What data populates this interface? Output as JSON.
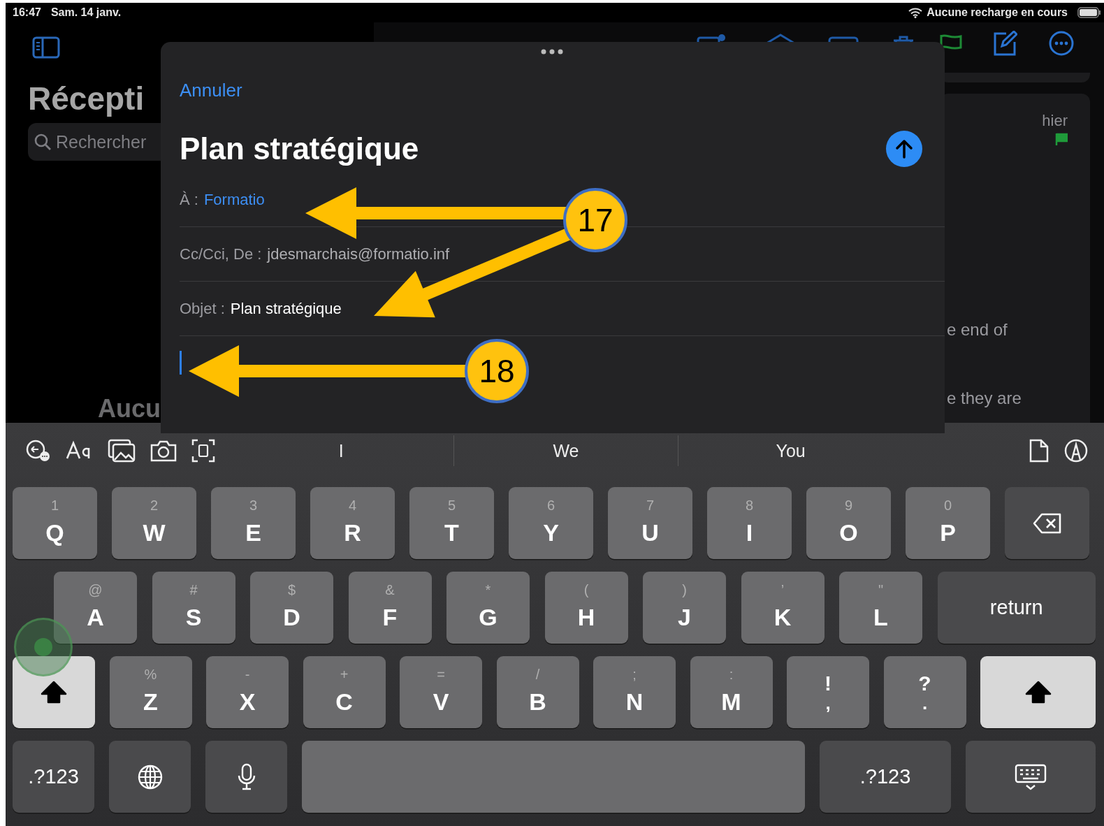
{
  "status_bar": {
    "time": "16:47",
    "date": "Sam. 14 janv.",
    "battery_text": "Aucune recharge en cours"
  },
  "sidebar": {
    "title": "Récepti",
    "search": {
      "placeholder": "Rechercher"
    },
    "empty_text": "Aucu"
  },
  "message_preview": {
    "date": "hier",
    "flagged": true,
    "lines": [
      "e end of",
      "e they are"
    ]
  },
  "compose": {
    "cancel": "Annuler",
    "title": "Plan stratégique",
    "fields": [
      {
        "label": "À :",
        "value": "Formatio",
        "kind": "recipient"
      },
      {
        "label": "Cc/Cci, De :",
        "value": "jdesmarchais@formatio.inf",
        "kind": "plain"
      },
      {
        "label": "Objet :",
        "value": "Plan stratégique",
        "kind": "subject"
      }
    ]
  },
  "keyboard": {
    "suggestions": [
      "I",
      "We",
      "You"
    ],
    "rows": [
      {
        "keys": [
          {
            "kind": "letter",
            "hint": "1",
            "label": "Q"
          },
          {
            "kind": "letter",
            "hint": "2",
            "label": "W"
          },
          {
            "kind": "letter",
            "hint": "3",
            "label": "E"
          },
          {
            "kind": "letter",
            "hint": "4",
            "label": "R"
          },
          {
            "kind": "letter",
            "hint": "5",
            "label": "T"
          },
          {
            "kind": "letter",
            "hint": "6",
            "label": "Y"
          },
          {
            "kind": "letter",
            "hint": "7",
            "label": "U"
          },
          {
            "kind": "letter",
            "hint": "8",
            "label": "I"
          },
          {
            "kind": "letter",
            "hint": "9",
            "label": "O"
          },
          {
            "kind": "letter",
            "hint": "0",
            "label": "P"
          },
          {
            "kind": "delete"
          }
        ]
      },
      {
        "keys": [
          {
            "kind": "letter",
            "hint": "@",
            "label": "A"
          },
          {
            "kind": "letter",
            "hint": "#",
            "label": "S"
          },
          {
            "kind": "letter",
            "hint": "$",
            "label": "D"
          },
          {
            "kind": "letter",
            "hint": "&",
            "label": "F"
          },
          {
            "kind": "letter",
            "hint": "*",
            "label": "G"
          },
          {
            "kind": "letter",
            "hint": "(",
            "label": "H"
          },
          {
            "kind": "letter",
            "hint": ")",
            "label": "J"
          },
          {
            "kind": "letter",
            "hint": "’",
            "label": "K"
          },
          {
            "kind": "letter",
            "hint": "\"",
            "label": "L"
          },
          {
            "kind": "return",
            "label": "return"
          }
        ]
      },
      {
        "keys": [
          {
            "kind": "shift",
            "on": true
          },
          {
            "kind": "letter",
            "hint": "%",
            "label": "Z"
          },
          {
            "kind": "letter",
            "hint": "-",
            "label": "X"
          },
          {
            "kind": "letter",
            "hint": "+",
            "label": "C"
          },
          {
            "kind": "letter",
            "hint": "=",
            "label": "V"
          },
          {
            "kind": "letter",
            "hint": "/",
            "label": "B"
          },
          {
            "kind": "letter",
            "hint": ";",
            "label": "N"
          },
          {
            "kind": "letter",
            "hint": ":",
            "label": "M"
          },
          {
            "kind": "punct",
            "top": "!",
            "bottom": ","
          },
          {
            "kind": "punct",
            "top": "?",
            "bottom": "."
          },
          {
            "kind": "shift",
            "on": true
          }
        ]
      },
      {
        "keys": [
          {
            "kind": "mode",
            "label": ".?123"
          },
          {
            "kind": "globe"
          },
          {
            "kind": "mic"
          },
          {
            "kind": "space"
          },
          {
            "kind": "mode",
            "label": ".?123"
          },
          {
            "kind": "hide"
          }
        ]
      }
    ]
  },
  "annotations": [
    {
      "number": "17"
    },
    {
      "number": "18"
    }
  ]
}
